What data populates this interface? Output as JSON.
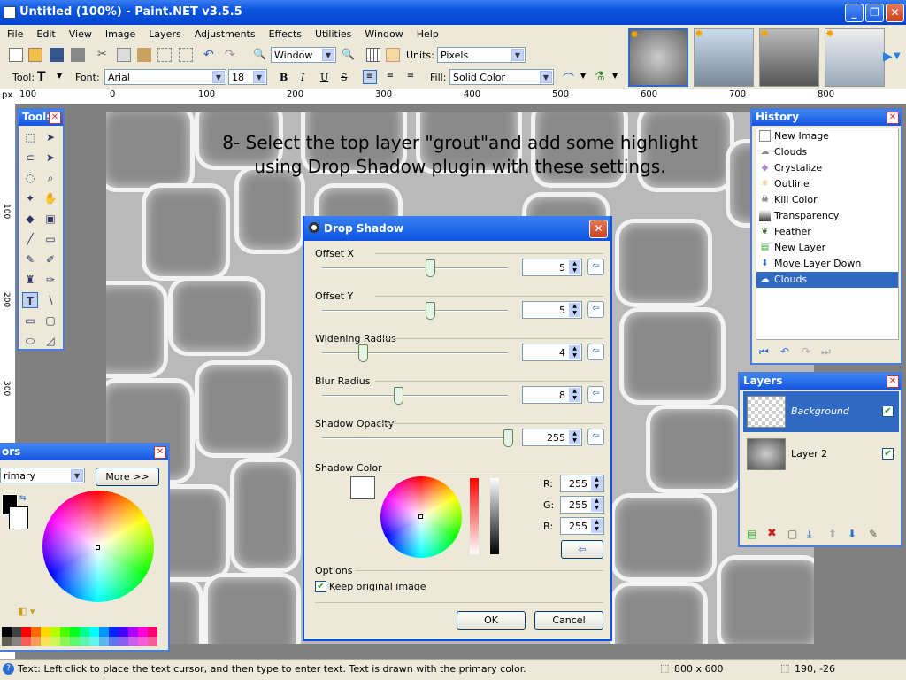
{
  "window": {
    "title": "Untitled (100%) - Paint.NET v3.5.5"
  },
  "menu": [
    "File",
    "Edit",
    "View",
    "Image",
    "Layers",
    "Adjustments",
    "Effects",
    "Utilities",
    "Window",
    "Help"
  ],
  "toolbar": {
    "zoom_value": "Window",
    "units_label": "Units:",
    "units_value": "Pixels",
    "tool_label": "Tool:",
    "tool_glyph": "T",
    "font_label": "Font:",
    "font_value": "Arial",
    "font_size": "18",
    "bold": "B",
    "italic": "I",
    "underline": "U",
    "strike": "S",
    "fill_label": "Fill:",
    "fill_value": "Solid Color"
  },
  "ruler": {
    "unit": "px",
    "top_ticks": [
      "100",
      "0",
      "100",
      "200",
      "300",
      "400",
      "500",
      "600",
      "700",
      "800"
    ],
    "left_ticks": [
      "100",
      "200",
      "300"
    ]
  },
  "canvas": {
    "instruction_line1": "8- Select the top layer \"grout\"and add some highlight",
    "instruction_line2": "using Drop Shadow plugin with these settings."
  },
  "tools_panel": {
    "title": "Tools"
  },
  "history": {
    "title": "History",
    "items": [
      "New Image",
      "Clouds",
      "Crystalize",
      "Outline",
      "Kill Color",
      "Transparency",
      "Feather",
      "New Layer",
      "Move Layer Down",
      "Clouds"
    ],
    "selected_index": 9
  },
  "layers": {
    "title": "Layers",
    "items": [
      {
        "name": "Background",
        "visible": true,
        "selected": true
      },
      {
        "name": "Layer 2",
        "visible": true,
        "selected": false
      }
    ]
  },
  "colors": {
    "title": "ors",
    "mode": "rimary",
    "more_button": "More >>",
    "palette": [
      "#000000",
      "#404040",
      "#ff0000",
      "#ff6a00",
      "#ffd800",
      "#b6ff00",
      "#4cff00",
      "#00ff21",
      "#00ff90",
      "#00ffff",
      "#0094ff",
      "#0026ff",
      "#4800ff",
      "#b200ff",
      "#ff00dc",
      "#ff006e"
    ]
  },
  "dialog": {
    "title": "Drop Shadow",
    "fields": [
      {
        "label": "Offset X",
        "value": "5",
        "fraction": 0.58
      },
      {
        "label": "Offset Y",
        "value": "5",
        "fraction": 0.58
      },
      {
        "label": "Widening Radius",
        "value": "4",
        "fraction": 0.22
      },
      {
        "label": "Blur Radius",
        "value": "8",
        "fraction": 0.41
      },
      {
        "label": "Shadow Opacity",
        "value": "255",
        "fraction": 1.0
      }
    ],
    "shadow_color_label": "Shadow Color",
    "rgb": {
      "r_label": "R:",
      "r": "255",
      "g_label": "G:",
      "g": "255",
      "b_label": "B:",
      "b": "255"
    },
    "options_label": "Options",
    "keep_original_label": "Keep original image",
    "keep_original_checked": true,
    "ok": "OK",
    "cancel": "Cancel"
  },
  "status": {
    "hint": "Text: Left click to place the text cursor, and then type to enter text. Text is drawn with the primary color.",
    "size": "800 x 600",
    "coords": "190, -26"
  }
}
